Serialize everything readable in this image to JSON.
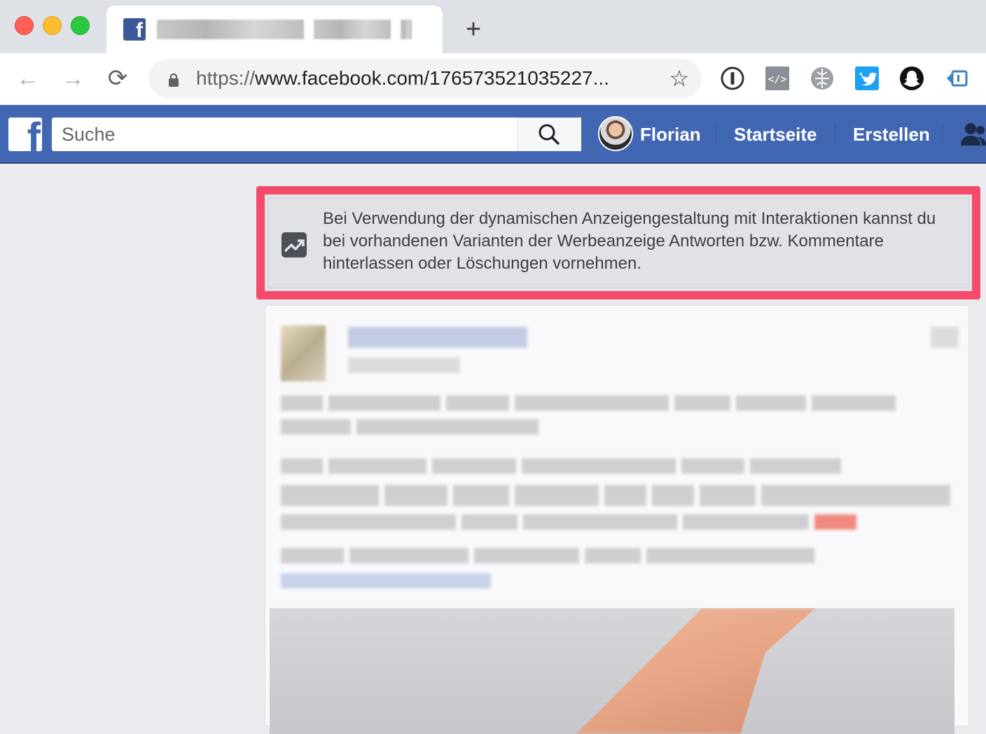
{
  "browser": {
    "tab": {
      "title": "",
      "favicon": "facebook-icon"
    },
    "new_tab_label": "+",
    "url": {
      "scheme": "https://",
      "rest": "www.facebook.com/176573521035227..."
    },
    "nav": {
      "back": "←",
      "forward": "→",
      "reload": "⟳"
    },
    "bookmark_star": "☆",
    "extensions": [
      "1password-icon",
      "code-icon",
      "globe-extension-icon",
      "tweetdeck-icon",
      "snapchat-icon",
      "screen-extension-icon"
    ]
  },
  "facebook": {
    "brand_color": "#4267b2",
    "logo": "f",
    "search": {
      "placeholder": "Suche"
    },
    "user": {
      "name": "Florian"
    },
    "nav": {
      "home": "Startseite",
      "create": "Erstellen"
    }
  },
  "notice": {
    "highlight_color": "#f44a6c",
    "icon": "image-chart-icon",
    "text": "Bei Verwendung der dynamischen Anzeigengestaltung mit Interaktionen kannst du bei vorhandenen Varianten der Werbeanzeige Antworten bzw. Kommentare hinterlassen oder Löschungen vornehmen."
  }
}
